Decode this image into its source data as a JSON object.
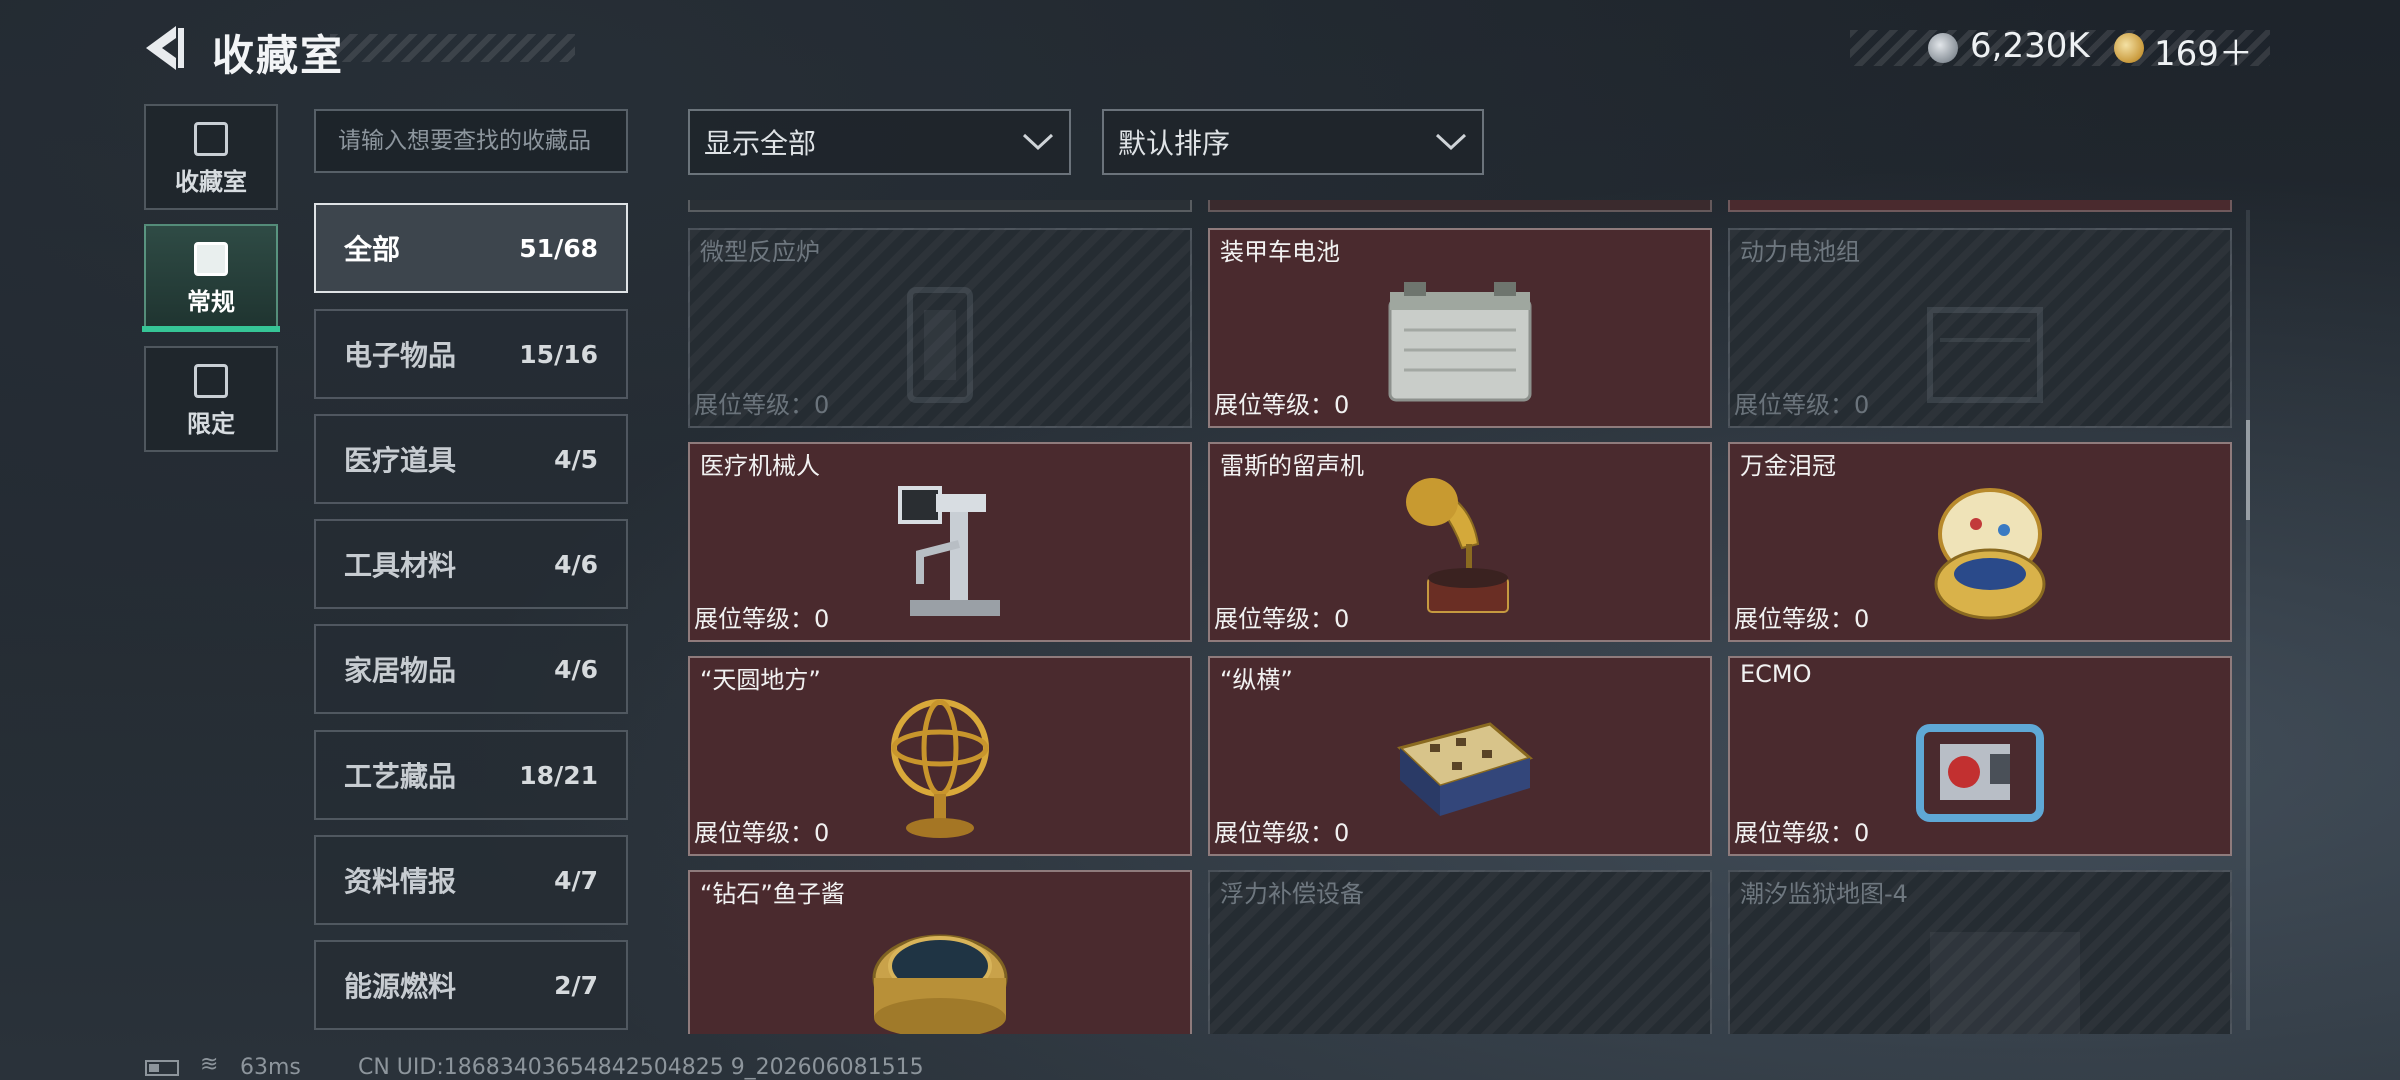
{
  "header": {
    "title": "收藏室",
    "currencies": [
      {
        "icon": "silver-coin-icon",
        "value": "6,230K"
      },
      {
        "icon": "gold-coin-icon",
        "value": "169＋"
      }
    ]
  },
  "mode_tabs": [
    {
      "label": "收藏室",
      "icon": "vault-icon",
      "active": false
    },
    {
      "label": "常规",
      "icon": "document-icon",
      "active": true
    },
    {
      "label": "限定",
      "icon": "limited-icon",
      "active": false
    }
  ],
  "search": {
    "placeholder": "请输入想要查找的收藏品"
  },
  "categories": [
    {
      "name": "全部",
      "count": "51/68",
      "active": true
    },
    {
      "name": "电子物品",
      "count": "15/16",
      "active": false
    },
    {
      "name": "医疗道具",
      "count": "4/5",
      "active": false
    },
    {
      "name": "工具材料",
      "count": "4/6",
      "active": false
    },
    {
      "name": "家居物品",
      "count": "4/6",
      "active": false
    },
    {
      "name": "工艺藏品",
      "count": "18/21",
      "active": false
    },
    {
      "name": "资料情报",
      "count": "4/7",
      "active": false
    },
    {
      "name": "能源燃料",
      "count": "2/7",
      "active": false
    }
  ],
  "filters": {
    "display": "显示全部",
    "sort": "默认排序"
  },
  "items": [
    {
      "name": "微型反应炉",
      "level": "展位等级：0",
      "owned": false
    },
    {
      "name": "装甲车电池",
      "level": "展位等级：0",
      "owned": true
    },
    {
      "name": "动力电池组",
      "level": "展位等级：0",
      "owned": false
    },
    {
      "name": "医疗机械人",
      "level": "展位等级：0",
      "owned": true
    },
    {
      "name": "雷斯的留声机",
      "level": "展位等级：0",
      "owned": true
    },
    {
      "name": "万金泪冠",
      "level": "展位等级：0",
      "owned": true
    },
    {
      "name": "“天圆地方”",
      "level": "展位等级：0",
      "owned": true
    },
    {
      "name": "“纵横”",
      "level": "展位等级：0",
      "owned": true
    },
    {
      "name": "ECMO",
      "level": "展位等级：0",
      "owned": true
    },
    {
      "name": "“钻石”鱼子酱",
      "level": "",
      "owned": true
    },
    {
      "name": "浮力补偿设备",
      "level": "",
      "owned": false
    },
    {
      "name": "潮汐监狱地图-4",
      "level": "",
      "owned": false
    }
  ],
  "colors": {
    "owned_card": "#4a2a2e",
    "accent": "#36c596"
  },
  "footer": {
    "ping": "63ms",
    "uid": "CN UID:18683403654842504825 9_202606081515"
  }
}
